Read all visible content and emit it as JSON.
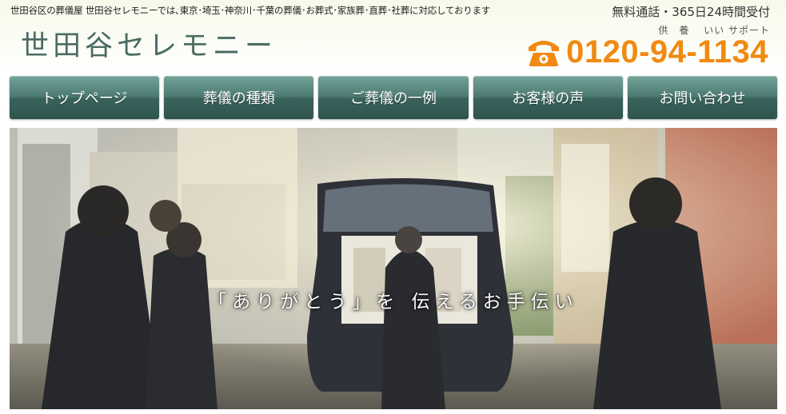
{
  "header": {
    "tagline": "世田谷区の葬儀屋 世田谷セレモニーでは､東京･埼玉･神奈川･千葉の葬儀･お葬式･家族葬･直葬･社葬に対応しております",
    "logo_text": "世田谷セレモニー",
    "hours": "無料通話・365日24時間受付",
    "phone_ruby": "供　養　 いい サポート",
    "phone_number": "0120-94-1134",
    "phone_icon": "telephone-icon",
    "accent_color": "#f08a12"
  },
  "nav": {
    "items": [
      {
        "label": "トップページ"
      },
      {
        "label": "葬儀の種類"
      },
      {
        "label": "ご葬儀の一例"
      },
      {
        "label": "お客様の声"
      },
      {
        "label": "お問い合わせ"
      }
    ],
    "color": "#4c7a72"
  },
  "hero": {
    "caption": "「ありがとう」を 伝えるお手伝い"
  }
}
